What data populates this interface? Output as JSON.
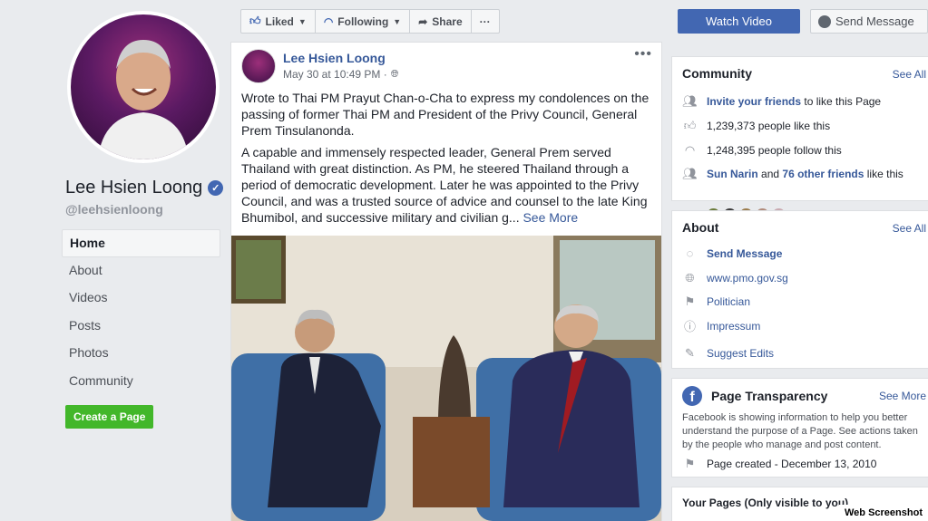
{
  "page": {
    "name": "Lee Hsien Loong",
    "handle": "@leehsienloong",
    "nav": [
      "Home",
      "About",
      "Videos",
      "Posts",
      "Photos",
      "Community"
    ],
    "create_page": "Create a Page"
  },
  "actions": {
    "liked": "Liked",
    "following": "Following",
    "share": "Share",
    "more": "···",
    "watch_video": "Watch Video",
    "send_message": "Send Message"
  },
  "post": {
    "author": "Lee Hsien Loong",
    "time": "May 30 at 10:49 PM ·",
    "more": "•••",
    "para1": "Wrote to Thai PM Prayut Chan-o-Cha to express my condolences on the passing of former Thai PM and President of the Privy Council, General Prem Tinsulanonda.",
    "para2": "A capable and immensely respected leader, General Prem served Thailand with great distinction. As PM, he steered Thailand through a period of democratic development. Later he was appointed to the Privy Council, and was a trusted source of advice and counsel to the late King Bhumibol, and successive military and civilian g...",
    "see_more": "See More"
  },
  "community": {
    "title": "Community",
    "see_all": "See All",
    "invite_link": "Invite your friends",
    "invite_rest": "to like this Page",
    "likes": "1,239,373 people like this",
    "follows": "1,248,395 people follow this",
    "friend_name": "Sun Narin",
    "friend_and": "and",
    "friend_others": "76 other friends",
    "friend_rest": "like this"
  },
  "about": {
    "title": "About",
    "see_all": "See All",
    "send_message": "Send Message",
    "website": "www.pmo.gov.sg",
    "category": "Politician",
    "impressum": "Impressum",
    "suggest": "Suggest Edits"
  },
  "transparency": {
    "title": "Page Transparency",
    "see_more": "See More",
    "desc": "Facebook is showing information to help you better understand the purpose of a Page. See actions taken by the people who manage and post content.",
    "created": "Page created - December 13, 2010"
  },
  "your_pages": {
    "title": "Your Pages (Only visible to you)"
  },
  "watermark": "Web Screenshot",
  "colors": {
    "fb_blue": "#4267b2",
    "link": "#365899",
    "green": "#42b72a",
    "bg": "#e9ebee"
  }
}
